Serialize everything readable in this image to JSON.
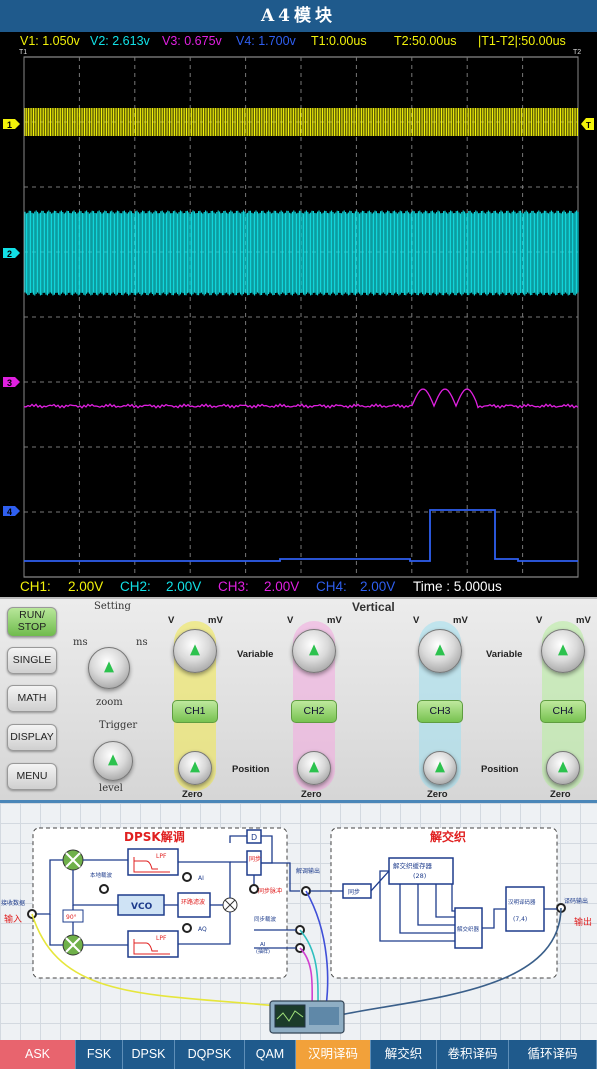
{
  "app": {
    "title": "A4模块"
  },
  "readout": {
    "v1": "V1: 1.050v",
    "v2": "V2: 2.613v",
    "v3": "V3: 0.675v",
    "v4": "V4: 1.700v",
    "t1": "T1:0.00us",
    "t2": "T2:50.00us",
    "dt": "|T1-T2|:50.00us"
  },
  "channels": {
    "ch1": {
      "label": "CH1:",
      "scale": "2.00V",
      "marker": "1",
      "color": "#f2f20a"
    },
    "ch2": {
      "label": "CH2:",
      "scale": "2.00V",
      "marker": "2",
      "color": "#12e0e6"
    },
    "ch3": {
      "label": "CH3:",
      "scale": "2.00V",
      "marker": "3",
      "color": "#e020e0"
    },
    "ch4": {
      "label": "CH4:",
      "scale": "2.00V",
      "marker": "4",
      "color": "#2f5ff0"
    }
  },
  "timebase": "Time : 5.000us",
  "cursor_labels": {
    "t1": "T1",
    "t2": "T2",
    "trigger": "T"
  },
  "panel": {
    "buttons": {
      "run_stop_1": "RUN/",
      "run_stop_2": "STOP",
      "single": "SINGLE",
      "math": "MATH",
      "display": "DISPLAY",
      "menu": "MENU"
    },
    "setting": "Setting",
    "ms": "ms",
    "ns": "ns",
    "zoom": "zoom",
    "trigger": "Trigger",
    "level": "level",
    "vertical": "Vertical",
    "v": "V",
    "mv": "mV",
    "variable": "Variable",
    "position": "Position",
    "zero": "Zero",
    "ch_buttons": [
      "CH1",
      "CH2",
      "CH3",
      "CH4"
    ]
  },
  "diagram": {
    "dpsk_title": "DPSK解调",
    "deinterleave_title": "解交织",
    "lpf": "LPF",
    "d_block": "D",
    "sync": "同步",
    "local_carrier": "本地载波",
    "ai": "AI",
    "aq": "AQ",
    "vco": "VCO",
    "loop_filter": "环路滤波",
    "sync_pulse": "同步脉冲",
    "phase90": "90°",
    "demod_out": "解调输出",
    "sync_carrier": "同步载波",
    "ai_sample": "AI",
    "ai_sample_sub": "(抽样)",
    "receive_data": "接收数据",
    "input": "输入",
    "sync2": "同步",
    "deint_buffer": "解交织缓存器",
    "deint_buffer_n": "(28)",
    "deinterleaver": "解交织器",
    "hamming_decoder": "汉明译码器",
    "hamming_params": "(7,4)",
    "decode_out": "译码输出",
    "output": "输出"
  },
  "tabs": [
    "ASK",
    "FSK",
    "DPSK",
    "DQPSK",
    "QAM",
    "汉明译码",
    "解交织",
    "卷积译码",
    "循环译码"
  ]
}
